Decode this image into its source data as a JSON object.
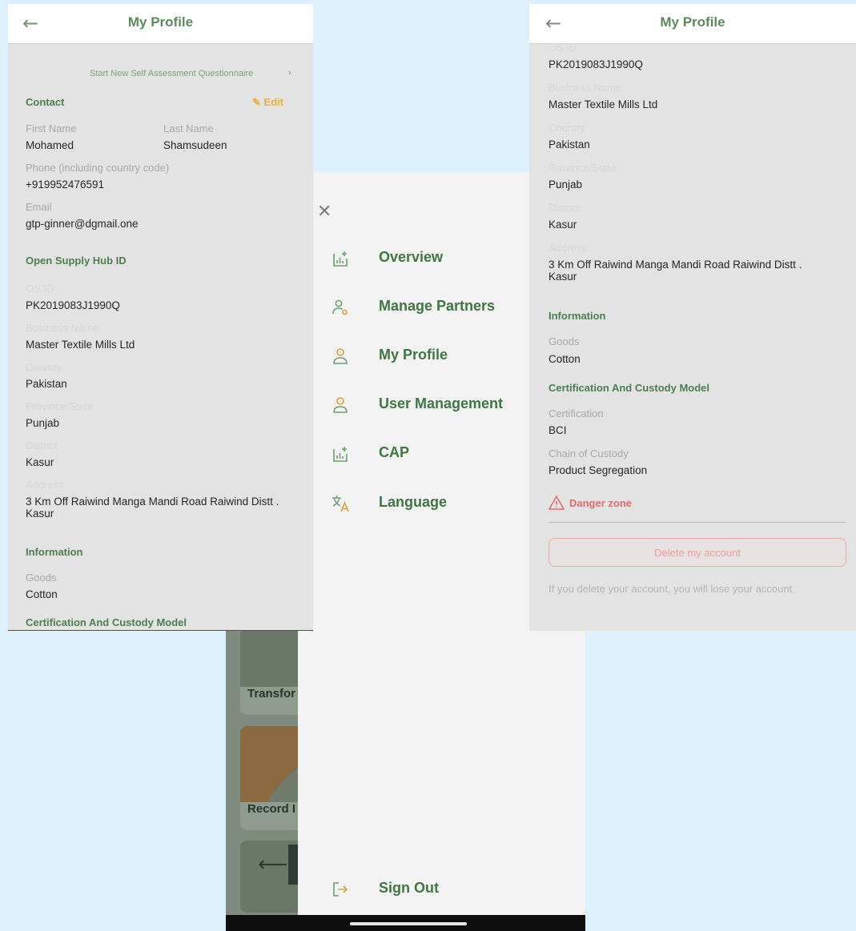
{
  "left_screen": {
    "title": "My Profile",
    "start_questionnaire": "Start New Self Assessment Questionnaire",
    "contact": {
      "heading": "Contact",
      "edit_label": "Edit",
      "first_name_label": "First Name",
      "first_name": "Mohamed",
      "last_name_label": "Last Name",
      "last_name": "Shamsudeen",
      "phone_label": "Phone (including country code)",
      "phone": "+919952476591",
      "email_label": "Email",
      "email": "gtp-ginner@dgmail.one"
    },
    "os_hub": {
      "heading": "Open Supply Hub ID",
      "os_id_label": "OS ID",
      "os_id": "PK2019083J1990Q",
      "business_label": "Business Name",
      "business": "Master Textile Mills Ltd",
      "country_label": "Country",
      "country": "Pakistan",
      "province_label": "Province/State",
      "province": "Punjab",
      "district_label": "District",
      "district": "Kasur",
      "address_label": "Address",
      "address": "3 Km Off Raiwind Manga Mandi Road Raiwind Distt . Kasur"
    },
    "information": {
      "heading": "Information",
      "goods_label": "Goods",
      "goods": "Cotton"
    },
    "certification_heading": "Certification And Custody Model"
  },
  "drawer": {
    "close_icon": "close-icon",
    "items": [
      {
        "label": "Overview",
        "icon": "chart-plus-icon"
      },
      {
        "label": "Manage Partners",
        "icon": "user-gear-icon"
      },
      {
        "label": "My Profile",
        "icon": "user-icon"
      },
      {
        "label": "User Management",
        "icon": "user-icon"
      },
      {
        "label": "CAP",
        "icon": "chart-plus-icon"
      },
      {
        "label": "Language",
        "icon": "translate-icon"
      }
    ],
    "sign_out": "Sign Out",
    "background_labels": [
      "Transfor",
      "Record I"
    ],
    "accent_color": "#3f7642"
  },
  "right_screen": {
    "title": "My Profile",
    "os_id_label": "OS ID",
    "os_id": "PK2019083J1990Q",
    "business_label": "Business Name",
    "business": "Master Textile Mills Ltd",
    "country_label": "Country",
    "country": "Pakistan",
    "province_label": "Province/State",
    "province": "Punjab",
    "district_label": "District",
    "district": "Kasur",
    "address_label": "Address",
    "address": "3 Km Off Raiwind Manga Mandi Road Raiwind Distt . Kasur",
    "information_heading": "Information",
    "goods_label": "Goods",
    "goods": "Cotton",
    "certification_heading": "Certification And Custody Model",
    "certification_label": "Certification",
    "certification": "BCI",
    "chain_label": "Chain of Custody",
    "chain": "Product Segregation",
    "danger_zone": "Danger zone",
    "delete_button": "Delete my account",
    "delete_note": "If you delete your account, you will lose your account."
  }
}
